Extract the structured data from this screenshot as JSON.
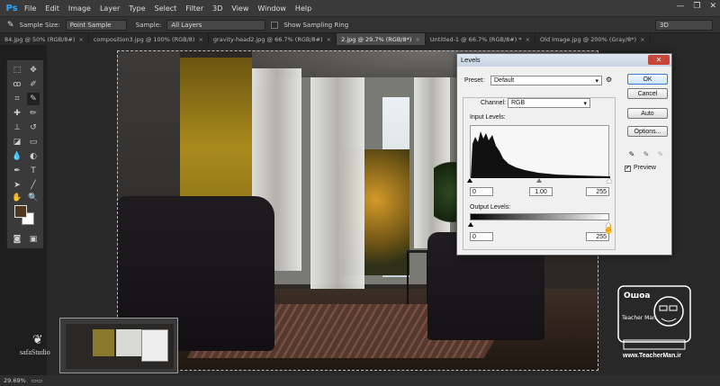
{
  "app": {
    "logo": "Ps",
    "menu": [
      "File",
      "Edit",
      "Image",
      "Layer",
      "Type",
      "Select",
      "Filter",
      "3D",
      "View",
      "Window",
      "Help"
    ],
    "window_controls": [
      "—",
      "❐",
      "✕"
    ]
  },
  "options_bar": {
    "sample_size_label": "Sample Size:",
    "sample_size_value": "Point Sample",
    "sample_label": "Sample:",
    "sample_value": "All Layers",
    "show_ring_label": "Show Sampling Ring",
    "workspace_value": "3D"
  },
  "tabs": [
    {
      "label": "84.jpg @ 50% (RGB/8#)",
      "active": false
    },
    {
      "label": "composition3.jpg @ 100% (RGB/8)",
      "active": false
    },
    {
      "label": "gravity-head2.jpg @ 66.7% (RGB/8#)",
      "active": false
    },
    {
      "label": "2.jpg @ 29.7% (RGB/8*)",
      "active": true
    },
    {
      "label": "Untitled-1 @ 66.7% (RGB/8#) *",
      "active": false
    },
    {
      "label": "Old Image.jpg @ 200% (Gray/8*)",
      "active": false
    }
  ],
  "tab_close_glyph": "×",
  "levels_dialog": {
    "title": "Levels",
    "close_glyph": "✕",
    "preset_label": "Preset:",
    "preset_value": "Default",
    "channel_label": "Channel:",
    "channel_value": "RGB",
    "input_levels_label": "Input Levels:",
    "input_black": "0",
    "input_gamma": "1.00",
    "input_white": "255",
    "output_levels_label": "Output Levels:",
    "output_black": "0",
    "output_white": "255",
    "buttons": {
      "ok": "OK",
      "cancel": "Cancel",
      "auto": "Auto",
      "options": "Options..."
    },
    "preview_label": "Preview",
    "preview_checked": true
  },
  "status_bar": {
    "zoom": "29.69%"
  },
  "watermark": {
    "url": "www.TeacherMan.ir",
    "brand_top": "Ошоа",
    "brand_sub": "Teacher Man",
    "left_brand": "safaStudio"
  },
  "colors": {
    "foreground": "#4f3722",
    "background": "#ffffff",
    "accent": "#31a8ff"
  }
}
